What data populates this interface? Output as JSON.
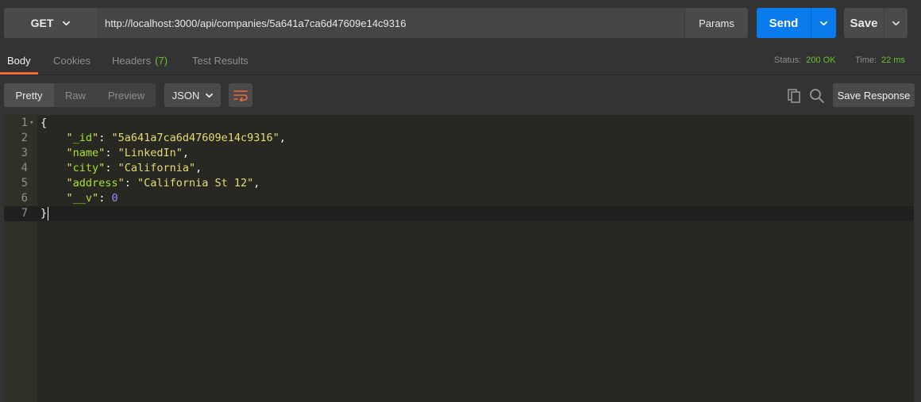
{
  "request": {
    "method": "GET",
    "url": "http://localhost:3000/api/companies/5a641a7ca6d47609e14c9316",
    "params_label": "Params",
    "send_label": "Send",
    "save_label": "Save"
  },
  "response_tabs": [
    {
      "label": "Body",
      "active": true
    },
    {
      "label": "Cookies",
      "active": false
    },
    {
      "label": "Headers",
      "count": "(7)",
      "active": false
    },
    {
      "label": "Test Results",
      "active": false
    }
  ],
  "status": {
    "label": "Status:",
    "value": "200 OK"
  },
  "time": {
    "label": "Time:",
    "value": "22 ms"
  },
  "view_modes": [
    "Pretty",
    "Raw",
    "Preview"
  ],
  "selected_view": "Pretty",
  "format": "JSON",
  "save_response_label": "Save Response",
  "colors": {
    "send_blue": "#097bed",
    "status_green": "#69c32b",
    "active_tab_underline": "#f26b3a",
    "editor_bg": "#272822",
    "json_key": "#a6e22e",
    "json_string": "#e6db74",
    "json_number": "#ae81ff"
  },
  "icons": {
    "method_dropdown": "chevron-down-icon",
    "send_dropdown": "chevron-down-icon",
    "save_dropdown": "chevron-down-icon",
    "format_dropdown": "chevron-down-icon",
    "wrap": "wrap-lines-icon",
    "copy": "copy-icon",
    "search": "search-icon"
  },
  "body_lines": [
    {
      "num": "1",
      "fold": true,
      "open": "{"
    },
    {
      "num": "2",
      "key": "_id",
      "value": "5a641a7ca6d47609e14c9316",
      "type": "string",
      "comma": true
    },
    {
      "num": "3",
      "key": "name",
      "value": "LinkedIn",
      "type": "string",
      "comma": true
    },
    {
      "num": "4",
      "key": "city",
      "value": "California",
      "type": "string",
      "comma": true
    },
    {
      "num": "5",
      "key": "address",
      "value": "California St 12",
      "type": "string",
      "comma": true
    },
    {
      "num": "6",
      "key": "__v",
      "value": "0",
      "type": "number",
      "comma": false
    },
    {
      "num": "7",
      "close": "}",
      "current": true
    }
  ]
}
